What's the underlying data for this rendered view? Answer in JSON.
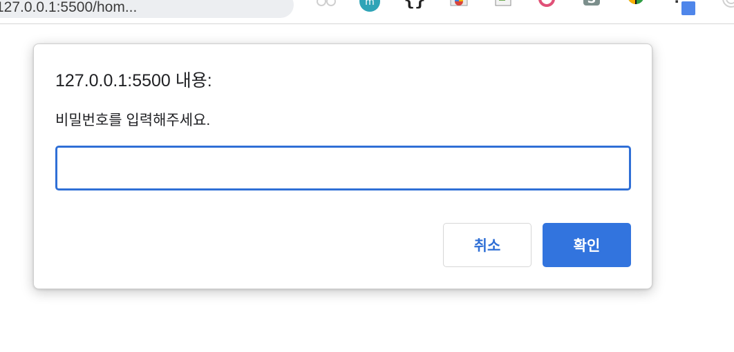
{
  "browser": {
    "url_text": "127.0.0.1:5500/hom...",
    "accent_color": "#3274de",
    "extensions": [
      "glasses-extension-icon",
      "m-extension-icon",
      "json-braces-extension-icon",
      "photo-extension-icon",
      "document-extension-icon",
      "ring-extension-icon",
      "s-extension-icon",
      "color-picker-extension-icon",
      "question-extension-icon",
      "target-extension-icon"
    ]
  },
  "dialog": {
    "title": "127.0.0.1:5500 내용:",
    "message": "비밀번호를 입력해주세요.",
    "input": {
      "value": "",
      "placeholder": ""
    },
    "cancel_label": "취소",
    "ok_label": "확인"
  }
}
